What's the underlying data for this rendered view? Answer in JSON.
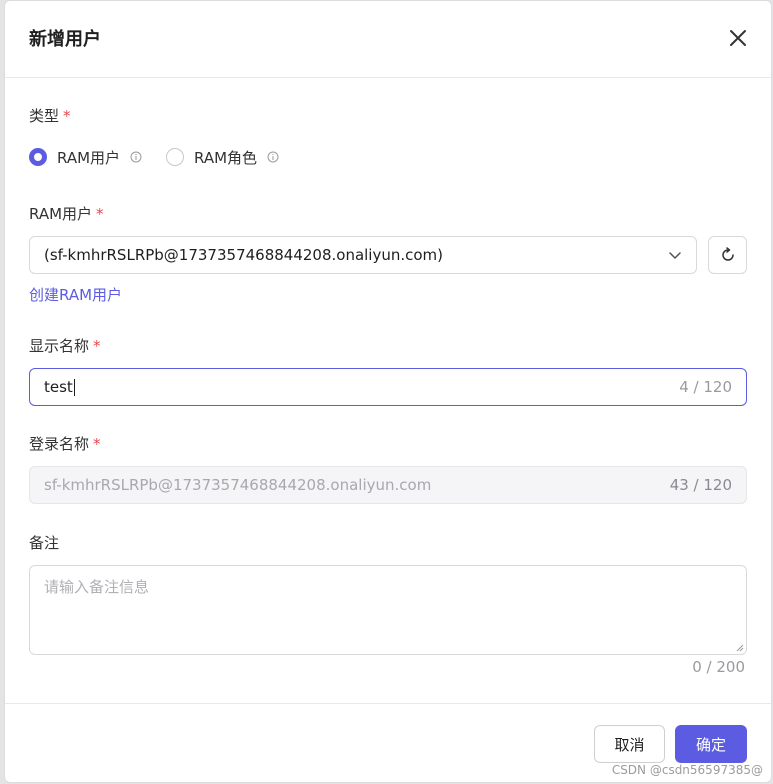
{
  "dialog": {
    "title": "新增用户",
    "close_icon": "close-icon"
  },
  "type_field": {
    "label": "类型",
    "required_mark": "*",
    "options": [
      {
        "label": "RAM用户",
        "checked": true
      },
      {
        "label": "RAM角色",
        "checked": false
      }
    ]
  },
  "ram_user_field": {
    "label": "RAM用户",
    "required_mark": "*",
    "selected_value": "(sf-kmhrRSLRPb@1737357468844208.onaliyun.com)",
    "refresh_icon": "refresh-icon",
    "create_link": "创建RAM用户"
  },
  "display_name_field": {
    "label": "显示名称",
    "required_mark": "*",
    "value": "test",
    "counter": "4 / 120"
  },
  "login_name_field": {
    "label": "登录名称",
    "required_mark": "*",
    "value": "sf-kmhrRSLRPb@1737357468844208.onaliyun.com",
    "counter": "43 / 120"
  },
  "remark_field": {
    "label": "备注",
    "placeholder": "请输入备注信息",
    "counter": "0 / 200"
  },
  "footer": {
    "cancel_label": "取消",
    "ok_label": "确定"
  },
  "watermark": "CSDN @csdn56597385@",
  "colors": {
    "accent": "#5b5ce2",
    "required": "#e5484d"
  }
}
